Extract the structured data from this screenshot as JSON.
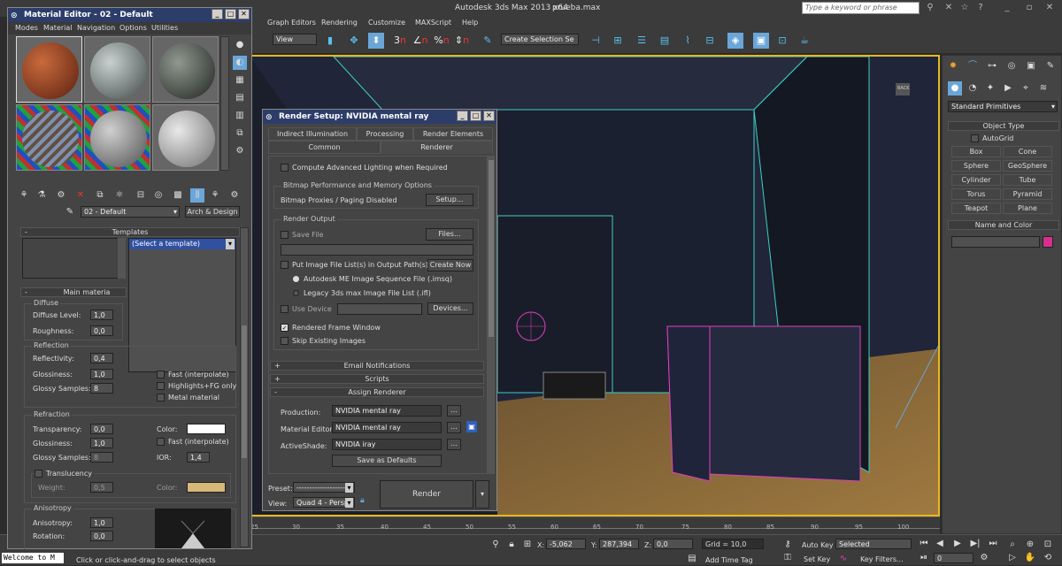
{
  "app": {
    "title": "Autodesk 3ds Max  2013 x64",
    "file": "prueba.max",
    "search_placeholder": "Type a keyword or phrase",
    "menus": [
      "Graph Editors",
      "Rendering",
      "Customize",
      "MAXScript",
      "Help"
    ],
    "toolbar": {
      "view_select": "View",
      "selection_set": "Create Selection Se"
    }
  },
  "material_editor": {
    "title": "Material Editor - 02 - Default",
    "menus": [
      "Modes",
      "Material",
      "Navigation",
      "Options",
      "Utilities"
    ],
    "material_name": "02 - Default",
    "material_type": "Arch & Design",
    "templates_header": "Templates",
    "template_select": "(Select a template)",
    "main_header": "Main materia",
    "diffuse": {
      "title": "Diffuse",
      "level_label": "Diffuse Level:",
      "level": "1,0",
      "roughness_label": "Roughness:",
      "roughness": "0,0"
    },
    "reflection": {
      "title": "Reflection",
      "reflectivity_label": "Reflectivity:",
      "reflectivity": "0,4",
      "glossiness_label": "Glossiness:",
      "glossiness": "1,0",
      "samples_label": "Glossy Samples:",
      "samples": "8",
      "fast": "Fast (interpolate)",
      "highlights": "Highlights+FG only",
      "metal": "Metal material"
    },
    "refraction": {
      "title": "Refraction",
      "transparency_label": "Transparency:",
      "transparency": "0,0",
      "glossiness_label": "Glossiness:",
      "glossiness": "1,0",
      "samples_label": "Glossy Samples:",
      "samples": "8",
      "color_label": "Color:",
      "fast": "Fast (interpolate)",
      "ior_label": "IOR:",
      "ior": "1,4"
    },
    "translucency": {
      "title": "Translucency",
      "weight_label": "Weight:",
      "weight": "0,5",
      "color_label": "Color:"
    },
    "anisotropy": {
      "title": "Anisotropy",
      "anisotropy_label": "Anisotropy:",
      "anisotropy": "1,0",
      "rotation_label": "Rotation:",
      "rotation": "0,0"
    }
  },
  "render_setup": {
    "title": "Render Setup: NVIDIA mental ray",
    "tabs_row1": [
      "Indirect Illumination",
      "Processing",
      "Render Elements"
    ],
    "tabs_row2": [
      "Common",
      "Renderer"
    ],
    "adv_lighting": "Compute Advanced Lighting when Required",
    "bitmap_group": "Bitmap Performance and Memory Options",
    "bitmap_label": "Bitmap Proxies / Paging Disabled",
    "setup_btn": "Setup...",
    "render_output": "Render Output",
    "save_file": "Save File",
    "files_btn": "Files...",
    "put_image": "Put Image File List(s) in Output Path(s)",
    "create_now": "Create Now",
    "radio1": "Autodesk ME Image Sequence File (.imsq)",
    "radio2": "Legacy 3ds max Image File List (.ifl)",
    "use_device": "Use Device",
    "devices_btn": "Devices...",
    "rendered_frame": "Rendered Frame Window",
    "skip_existing": "Skip Existing Images",
    "email": "Email Notifications",
    "scripts": "Scripts",
    "assign": "Assign Renderer",
    "production_label": "Production:",
    "production": "NVIDIA mental ray",
    "mat_editor_label": "Material Editor:",
    "mat_editor": "NVIDIA mental ray",
    "activeshade_label": "ActiveShade:",
    "activeshade": "NVIDIA iray",
    "save_defaults": "Save as Defaults",
    "preset_label": "Preset:",
    "preset": "-------------------",
    "view_label": "View:",
    "view": "Quad 4 - Perspe",
    "render_btn": "Render",
    "dots": "..."
  },
  "command_panel": {
    "dropdown": "Standard Primitives",
    "object_type": "Object Type",
    "autogrid": "AutoGrid",
    "buttons": [
      "Box",
      "Cone",
      "Sphere",
      "GeoSphere",
      "Cylinder",
      "Tube",
      "Torus",
      "Pyramid",
      "Teapot",
      "Plane"
    ],
    "name_color": "Name and Color"
  },
  "viewport": {
    "label": "BACK"
  },
  "timeline": {
    "ticks": [
      "25",
      "30",
      "35",
      "40",
      "45",
      "50",
      "55",
      "60",
      "65",
      "70",
      "75",
      "80",
      "85",
      "90",
      "95",
      "100"
    ]
  },
  "status": {
    "listener": "Welcome to M",
    "prompt": "Click or click-and-drag to select objects",
    "x_label": "X:",
    "x": "-5,062",
    "y_label": "Y:",
    "y": "287,394",
    "z_label": "Z:",
    "z": "0,0",
    "grid": "Grid = 10,0",
    "add_time_tag": "Add Time Tag",
    "auto_key": "Auto Key",
    "selected": "Selected",
    "set_key": "Set Key",
    "key_filters": "Key Filters...",
    "frame": "0"
  },
  "colors": {
    "wire_cyan": "#3fd0c0",
    "wire_pink": "#e040c0",
    "refraction_color": "#ffffff",
    "translucency_color": "#d8b878",
    "object_color": "#d8308a"
  }
}
